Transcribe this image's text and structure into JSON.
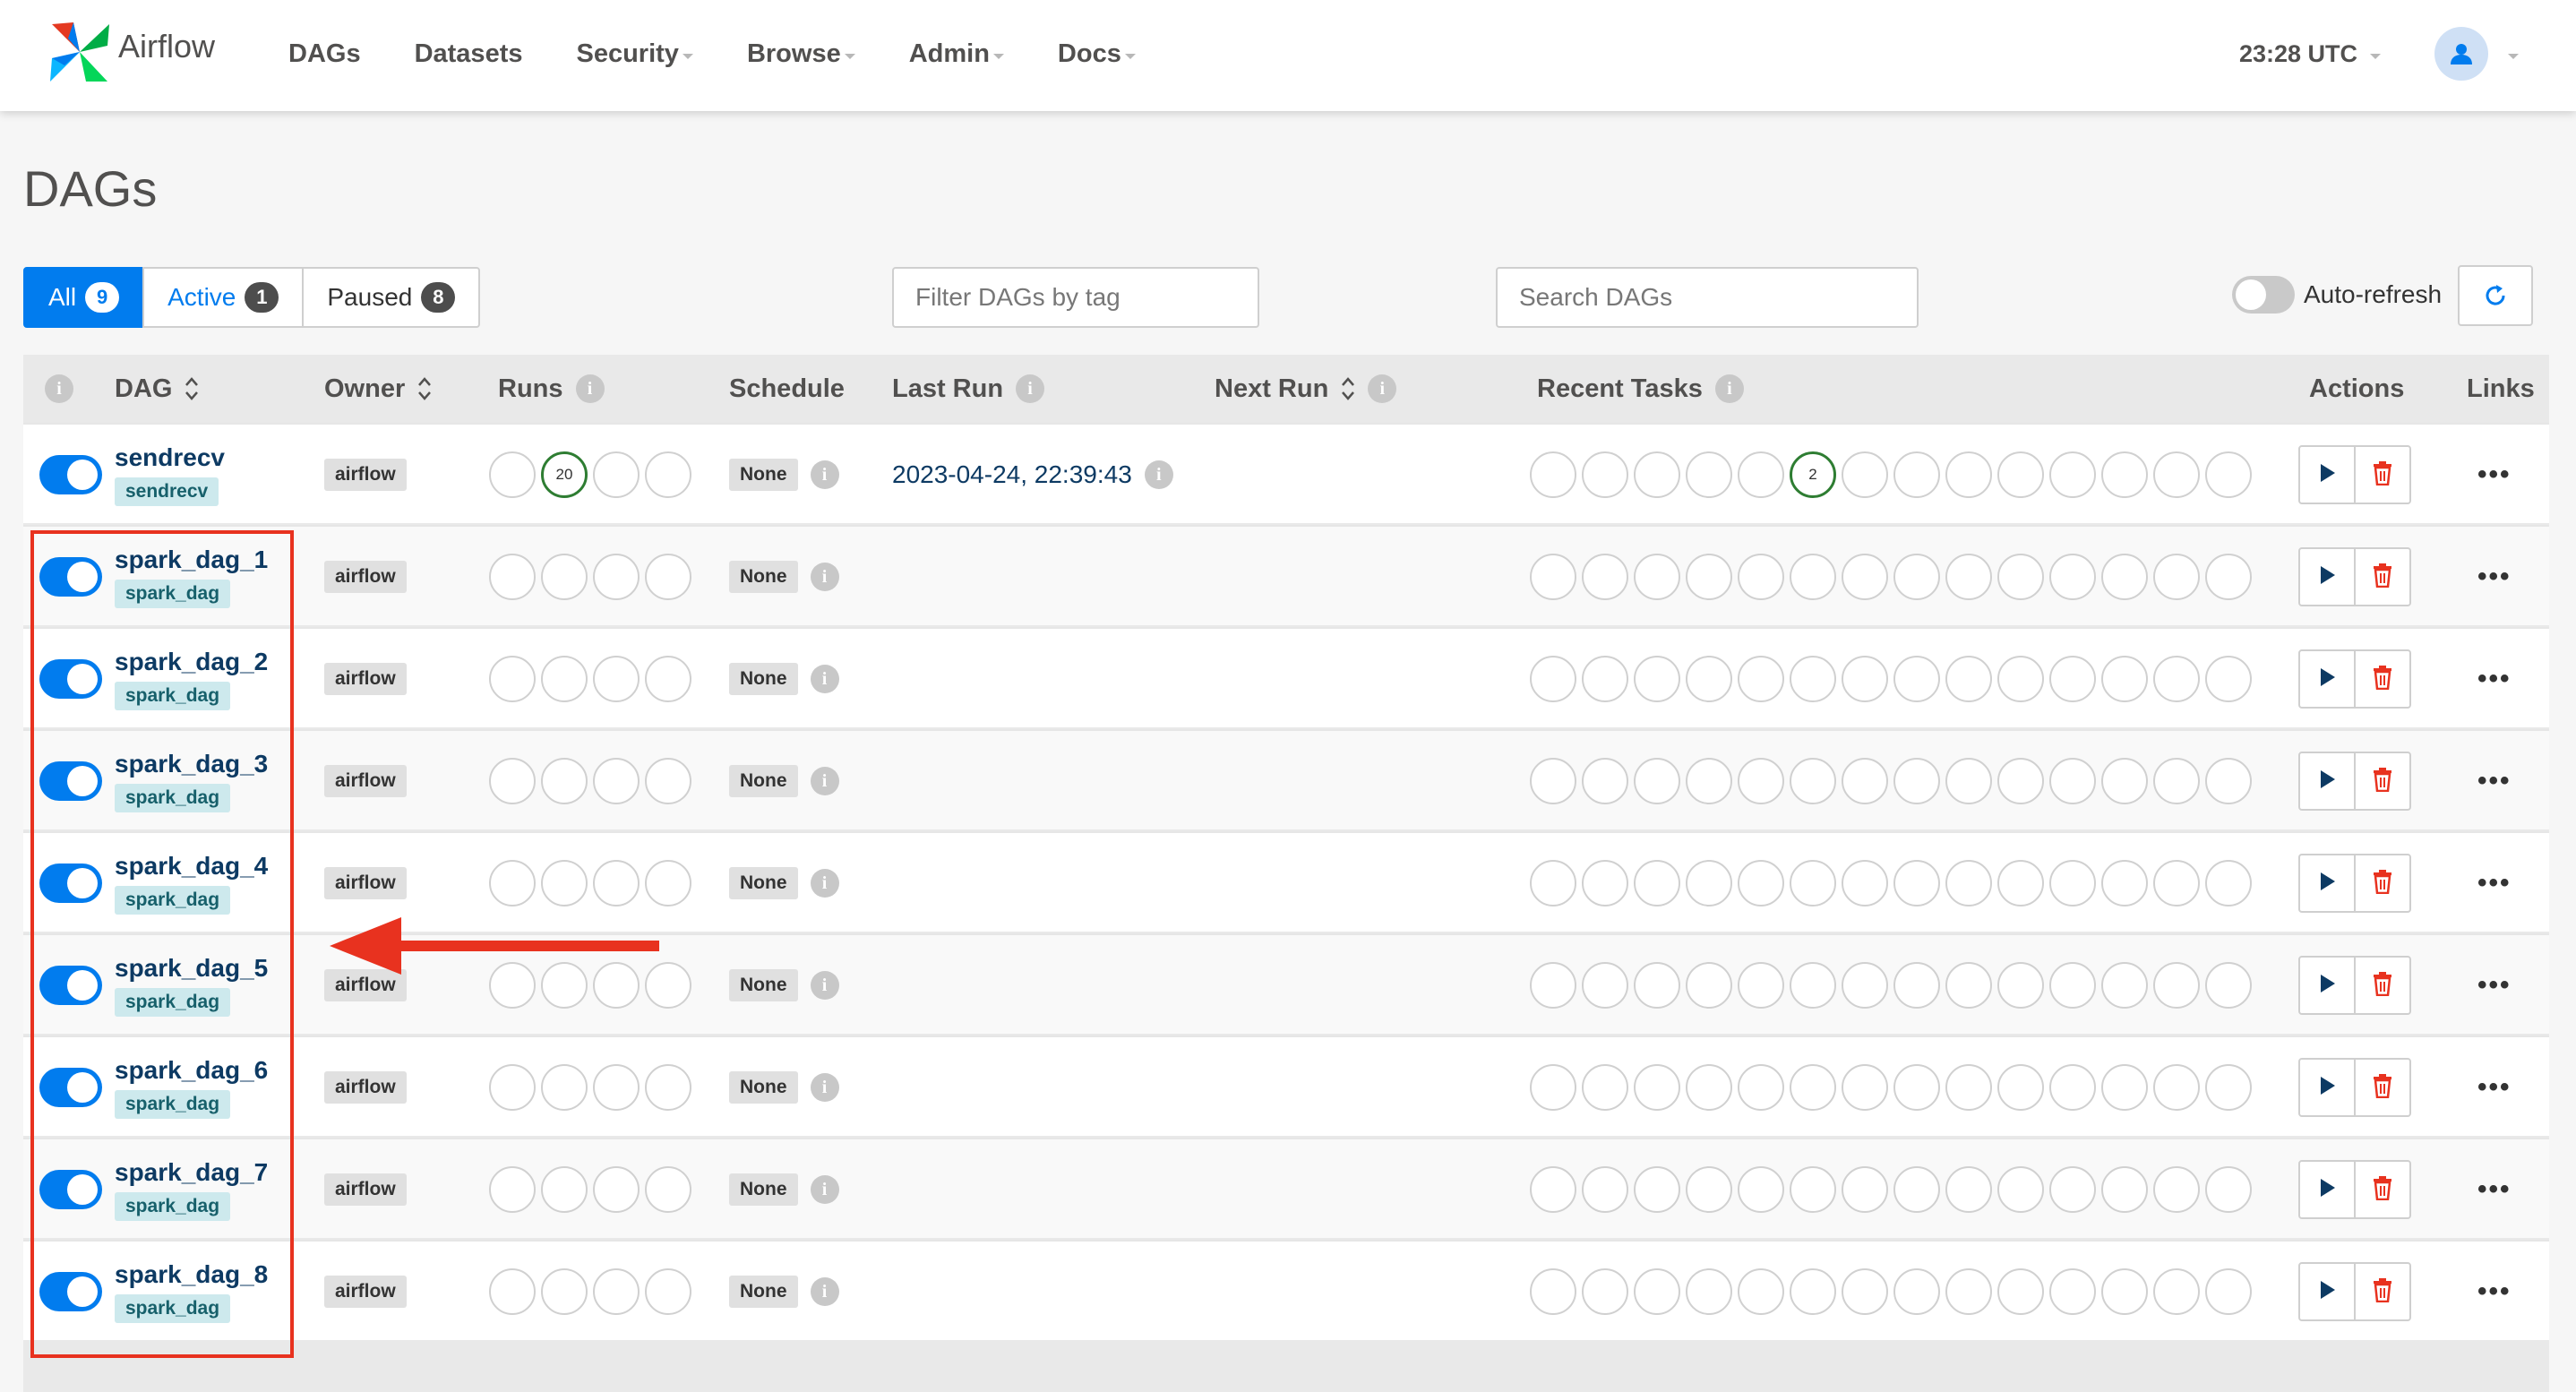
{
  "navbar": {
    "brand": "Airflow",
    "items": [
      {
        "label": "DAGs",
        "dropdown": false
      },
      {
        "label": "Datasets",
        "dropdown": false
      },
      {
        "label": "Security",
        "dropdown": true
      },
      {
        "label": "Browse",
        "dropdown": true
      },
      {
        "label": "Admin",
        "dropdown": true
      },
      {
        "label": "Docs",
        "dropdown": true
      }
    ],
    "clock": "23:28 UTC",
    "user_icon": "user-icon"
  },
  "page": {
    "title": "DAGs"
  },
  "filters": {
    "tabs": [
      {
        "label": "All",
        "count": "9",
        "active": true
      },
      {
        "label": "Active",
        "count": "1",
        "active": false
      },
      {
        "label": "Paused",
        "count": "8",
        "active": false
      }
    ],
    "tag_placeholder": "Filter DAGs by tag",
    "search_placeholder": "Search DAGs",
    "auto_refresh": "Auto-refresh"
  },
  "table": {
    "headers": {
      "info": "i",
      "dag": "DAG",
      "owner": "Owner",
      "runs": "Runs",
      "schedule": "Schedule",
      "last_run": "Last Run",
      "next_run": "Next Run",
      "recent_tasks": "Recent Tasks",
      "actions": "Actions",
      "links": "Links"
    },
    "rows": [
      {
        "name": "sendrecv",
        "tag": "sendrecv",
        "owner": "airflow",
        "schedule": "None",
        "last_run": "2023-04-24, 22:39:43",
        "runs_success": "20",
        "tasks_success": "2"
      },
      {
        "name": "spark_dag_1",
        "tag": "spark_dag",
        "owner": "airflow",
        "schedule": "None",
        "last_run": "",
        "runs_success": "",
        "tasks_success": ""
      },
      {
        "name": "spark_dag_2",
        "tag": "spark_dag",
        "owner": "airflow",
        "schedule": "None",
        "last_run": "",
        "runs_success": "",
        "tasks_success": ""
      },
      {
        "name": "spark_dag_3",
        "tag": "spark_dag",
        "owner": "airflow",
        "schedule": "None",
        "last_run": "",
        "runs_success": "",
        "tasks_success": ""
      },
      {
        "name": "spark_dag_4",
        "tag": "spark_dag",
        "owner": "airflow",
        "schedule": "None",
        "last_run": "",
        "runs_success": "",
        "tasks_success": ""
      },
      {
        "name": "spark_dag_5",
        "tag": "spark_dag",
        "owner": "airflow",
        "schedule": "None",
        "last_run": "",
        "runs_success": "",
        "tasks_success": ""
      },
      {
        "name": "spark_dag_6",
        "tag": "spark_dag",
        "owner": "airflow",
        "schedule": "None",
        "last_run": "",
        "runs_success": "",
        "tasks_success": ""
      },
      {
        "name": "spark_dag_7",
        "tag": "spark_dag",
        "owner": "airflow",
        "schedule": "None",
        "last_run": "",
        "runs_success": "",
        "tasks_success": ""
      },
      {
        "name": "spark_dag_8",
        "tag": "spark_dag",
        "owner": "airflow",
        "schedule": "None",
        "last_run": "",
        "runs_success": "",
        "tasks_success": ""
      }
    ],
    "links_glyph": "•••"
  },
  "colors": {
    "primary": "#017cee",
    "success": "#2e7d32",
    "danger": "#e8321f",
    "annotation": "#e8321f"
  }
}
